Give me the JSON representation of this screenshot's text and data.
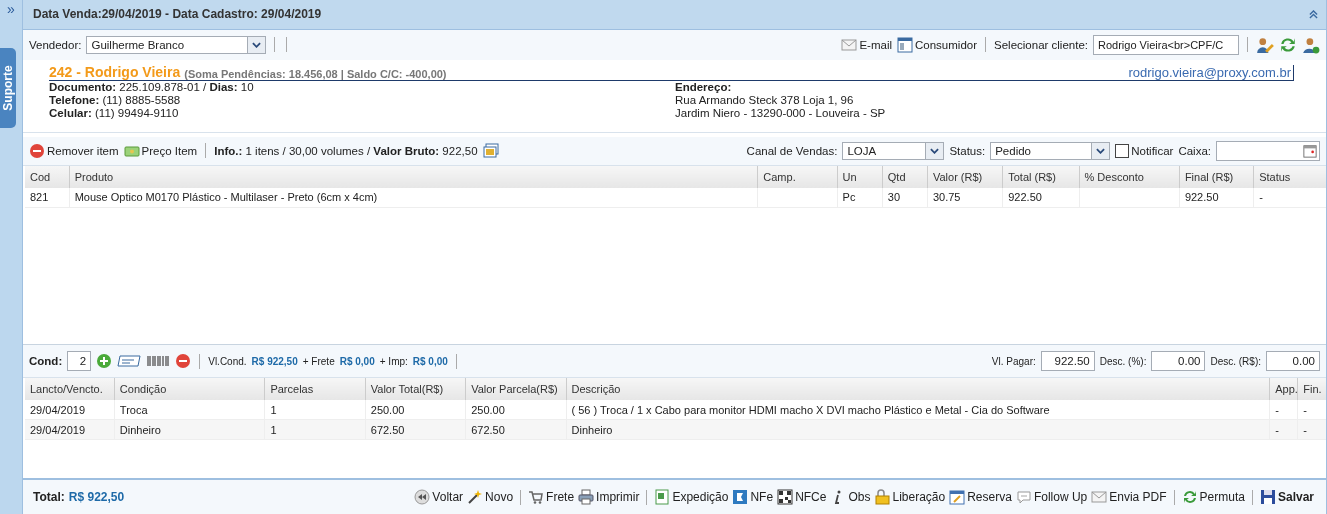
{
  "sidebar": {
    "toggle": "»",
    "tab": "Suporte"
  },
  "header": {
    "title": "Data Venda:29/04/2019 - Data Cadastro: 29/04/2019"
  },
  "toolbar": {
    "vendedor_label": "Vendedor:",
    "vendedor": "Guilherme Branco",
    "email": "E-mail",
    "consumidor": "Consumidor",
    "cliente_label": "Selecionar cliente:",
    "cliente": "Rodrigo Vieira<br>CPF/C"
  },
  "client": {
    "title": "242 - Rodrigo Vieira",
    "summary": "(Soma Pendências: 18.456,08 | Saldo C/C: -400,00)",
    "email": "rodrigo.vieira@proxy.com.br",
    "details": [
      "**Documento:** 225.109.878-01 / **Dias:** 10",
      "**Telefone:** (11) 8885-5588",
      "**Celular:** (11) 99494-9110"
    ],
    "address_label": "Endereço:",
    "address": [
      "Rua Armando Steck 378 Loja 1, 96",
      "Jardim Niero - 13290-000 - Louveira - SP"
    ]
  },
  "items_toolbar": {
    "actions": [
      {
        "kind": "remove",
        "label": "Remover item"
      },
      {
        "kind": "price",
        "label": "Preço Item"
      }
    ],
    "info": "**Info.:** 1 itens / 30,00 volumes / **Valor Bruto:** 922,50",
    "canal_label": "Canal de Vendas:",
    "canal": "LOJA",
    "status_label": "Status:",
    "status": "Pedido",
    "notificar": {
      "label": "Notificar",
      "checked": false
    },
    "caixa_label": "Caixa:"
  },
  "items_table": {
    "columns": [
      "Cod",
      "Produto",
      "Camp.",
      "Un",
      "Qtd",
      "Valor (R$)",
      "Total (R$)",
      "% Desconto",
      "Final (R$)",
      "Status"
    ],
    "rows": [
      [
        "821",
        "Mouse Optico M0170 Plástico - Multilaser - Preto (6cm x 4cm)",
        "",
        "Pc",
        "30",
        "30.75",
        "922.50",
        "",
        "922.50",
        "-"
      ]
    ]
  },
  "cond": {
    "label": "Cond:",
    "value": "2",
    "totals": [
      {
        "label": "Vl.Cond.",
        "value": "R$ 922,50"
      },
      {
        "label": "+ Frete",
        "value": "R$ 0,00"
      },
      {
        "label": "+ Imp:",
        "value": "R$ 0,00"
      }
    ],
    "fields": [
      {
        "label": "Vl. Pagar:",
        "value": "922.50"
      },
      {
        "label": "Desc. (%):",
        "value": "0.00"
      },
      {
        "label": "Desc. (R$):",
        "value": "0.00"
      }
    ]
  },
  "payments_table": {
    "columns": [
      "Lancto/Vencto.",
      "Condição",
      "Parcelas",
      "Valor Total(R$)",
      "Valor Parcela(R$)",
      "Descrição",
      "App.",
      "Fin."
    ],
    "rows": [
      [
        "29/04/2019",
        "Troca",
        "1",
        "250.00",
        "250.00",
        "( 56 ) Troca / 1 x Cabo para monitor HDMI macho X DVI macho Plástico e Metal - Cia do Software",
        "-",
        "-"
      ],
      [
        "29/04/2019",
        "Dinheiro",
        "1",
        "672.50",
        "672.50",
        "Dinheiro",
        "-",
        "-"
      ]
    ]
  },
  "footer": {
    "total_label": "Total:",
    "total": "R$ 922,50",
    "groups": [
      [
        {
          "kind": "back",
          "label": "Voltar"
        },
        {
          "kind": "wand",
          "label": "Novo"
        }
      ],
      [
        {
          "kind": "cart",
          "label": "Frete"
        },
        {
          "kind": "print",
          "label": "Imprimir"
        }
      ],
      [
        {
          "kind": "sheet",
          "label": "Expedição"
        },
        {
          "kind": "nfe",
          "label": "NFe"
        },
        {
          "kind": "qr",
          "label": "NFCe"
        },
        {
          "kind": "info",
          "label": "Obs"
        },
        {
          "kind": "lock",
          "label": "Liberação"
        },
        {
          "kind": "calendar",
          "label": "Reserva"
        },
        {
          "kind": "chat",
          "label": "Follow Up"
        },
        {
          "kind": "mail",
          "label": "Envia PDF"
        }
      ],
      [
        {
          "kind": "swap",
          "label": "Permuta"
        }
      ],
      [
        {
          "kind": "save",
          "label": "Salvar",
          "bold": true
        }
      ]
    ]
  }
}
